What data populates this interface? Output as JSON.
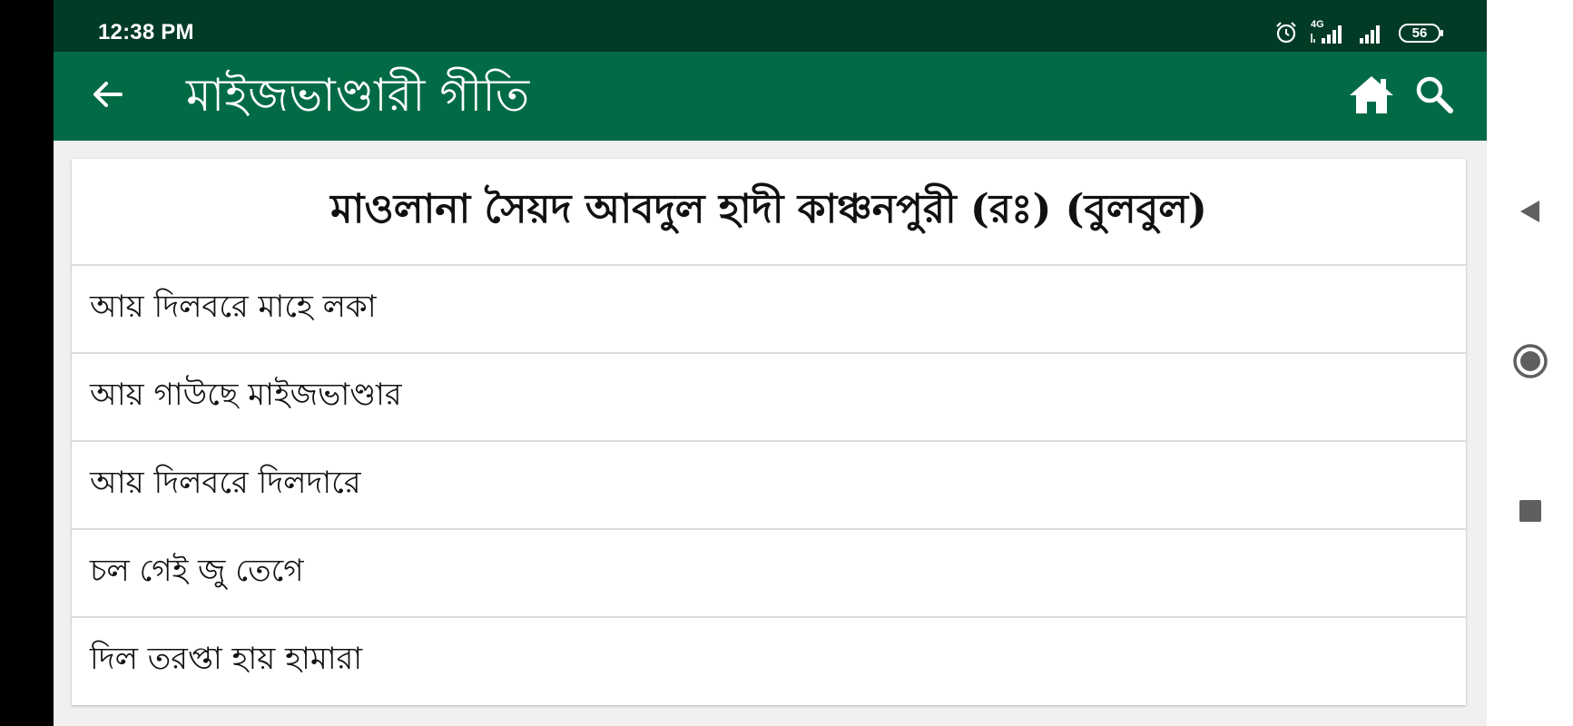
{
  "status_bar": {
    "time": "12:38 PM",
    "network_label": "4G",
    "battery": "56",
    "icons": [
      "alarm-icon",
      "signal-4g-icon",
      "signal-icon",
      "battery-icon"
    ]
  },
  "app_bar": {
    "title": "মাইজভাণ্ডারী গীতি",
    "icons": [
      "back-arrow-icon",
      "home-icon",
      "search-icon"
    ]
  },
  "card": {
    "title": "মাওলানা সৈয়দ আবদুল হাদী কাঞ্চনপুরী (রঃ) (বুলবুল)",
    "songs": [
      {
        "label": "আয় দিলবরে মাহে লকা"
      },
      {
        "label": "আয় গাউছে মাইজভাণ্ডার"
      },
      {
        "label": "আয় দিলবরে দিলদারে"
      },
      {
        "label": "চল গেই জু তেগে"
      },
      {
        "label": "দিল তরপ্তা হায় হামারা"
      }
    ]
  },
  "nav_bar": {
    "icons": [
      "back-triangle-icon",
      "home-circle-icon",
      "recents-square-icon"
    ]
  },
  "colors": {
    "status_bar": "#013b26",
    "app_bar": "#026b45",
    "background": "#f0f0f0"
  }
}
